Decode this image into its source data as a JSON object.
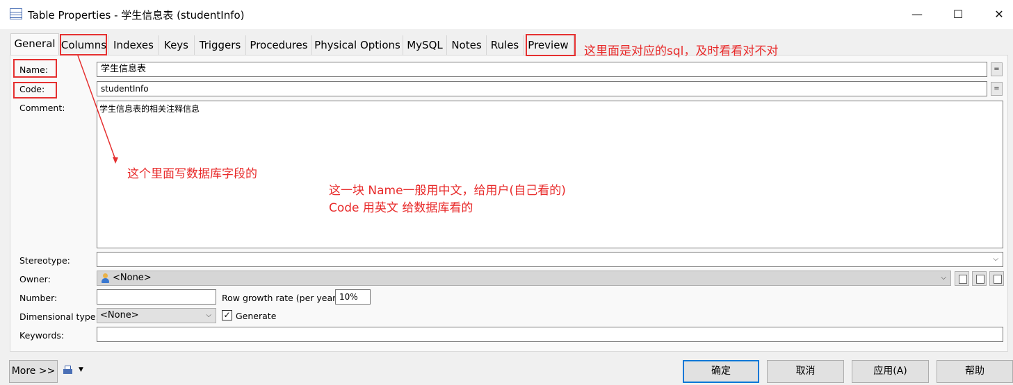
{
  "window": {
    "title": "Table Properties - 学生信息表 (studentInfo)",
    "minimize_glyph": "—",
    "maximize_glyph": "☐",
    "close_glyph": "✕"
  },
  "tabs": [
    "General",
    "Columns",
    "Indexes",
    "Keys",
    "Triggers",
    "Procedures",
    "Physical Options",
    "MySQL",
    "Notes",
    "Rules",
    "Preview"
  ],
  "active_tab": "General",
  "form": {
    "name_label": "Name:",
    "name_value": "学生信息表",
    "code_label": "Code:",
    "code_value": "studentInfo",
    "eq_glyph": "=",
    "comment_label": "Comment:",
    "comment_value": "学生信息表的相关注释信息",
    "stereotype_label": "Stereotype:",
    "stereotype_value": "",
    "owner_label": "Owner:",
    "owner_value": "<None>",
    "number_label": "Number:",
    "number_value": "",
    "row_growth_label": "Row growth rate (per year):",
    "row_growth_value": "10%",
    "dimensional_label": "Dimensional type:",
    "dimensional_value": "<None>",
    "generate_label": "Generate",
    "generate_checked": true,
    "keywords_label": "Keywords:",
    "keywords_value": ""
  },
  "footer": {
    "more_label": "More >>",
    "ok_label": "确定",
    "cancel_label": "取消",
    "apply_label": "应用(A)",
    "help_label": "帮助"
  },
  "annotations": {
    "preview_note": "这里面是对应的sql，及时看看对不对",
    "columns_note": "这个里面写数据库字段的",
    "name_code_note_1": "这一块 Name一般用中文，给用户(自己看的)",
    "name_code_note_2": "Code 用英文  给数据库看的",
    "color": "#e82a2a"
  },
  "icons": {
    "title_icon": "table-icon",
    "owner_icon": "user-icon",
    "footer_icon": "printer-icon",
    "check_glyph": "✓",
    "dropdown_glyph": "⌵"
  }
}
